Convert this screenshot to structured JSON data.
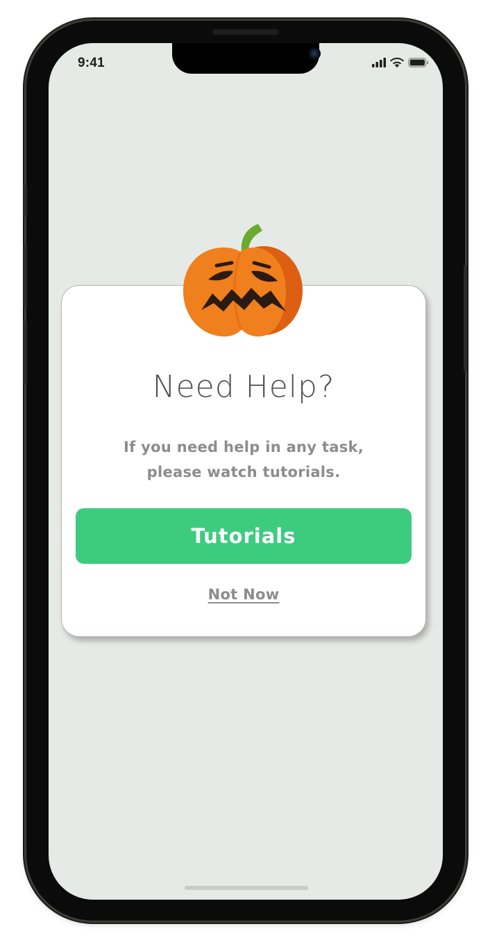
{
  "status_bar": {
    "time": "9:41",
    "icons": [
      "signal-icon",
      "wifi-icon",
      "battery-icon"
    ]
  },
  "dialog": {
    "title": "Need Help?",
    "message": "If you need help in any task, please watch tutorials.",
    "primary_button_label": "Tutorials",
    "secondary_link_label": "Not Now",
    "illustration": "pumpkin-icon"
  },
  "colors": {
    "primary": "#3dcb80",
    "screen_background": "#e6eae7",
    "card_background": "#ffffff",
    "muted_text": "#8c8c8c",
    "title_text": "#505050",
    "pumpkin_orange": "#f07f1d",
    "pumpkin_shadow": "#dc5f12",
    "pumpkin_stem": "#6aaa2f"
  }
}
